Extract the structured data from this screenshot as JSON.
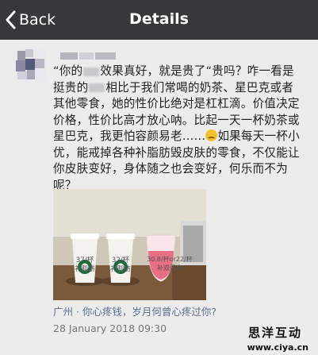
{
  "header": {
    "back_label": "Back",
    "title": "Details"
  },
  "post": {
    "lines": [
      "“你的",
      "效果真好，就是贵了“贵吗？咋一看是",
      "挺贵的",
      "相比于我们常喝的奶茶、星巴克或者",
      "其他零食，她的性价比绝对是杠杠滴。价值决定",
      "价格，性价比高才放心呐。比起一天一杯奶茶或",
      "星巴克，我更怕容颜易老……",
      "如果每天一杯小",
      "优，能戒掉各种补脂肪毁皮肤的零食，不仅能让",
      "你皮肤变好，身体随之也会变好，何乐而不为",
      "呢？"
    ],
    "emoji": "face-emoji"
  },
  "photo": {
    "cup1_label": "37/杯",
    "cup1_sub": "补脂肪",
    "cup2_label": "32/杯",
    "cup2_sub": "补脂肪",
    "cup3_label": "30.8/杯or22/杯",
    "cup3_sub": "补双蛋白"
  },
  "meta": {
    "location": "广州 · 你心疼钱，岁月何曾心疼过你?",
    "timestamp": "28 January 2018 09:30"
  },
  "watermark": {
    "cn": "思洋互动",
    "url": "www.ciya.cn"
  },
  "colors": {
    "header_bg": "#38383a",
    "page_bg": "#ececec",
    "link_blue": "#5d6d8f"
  }
}
